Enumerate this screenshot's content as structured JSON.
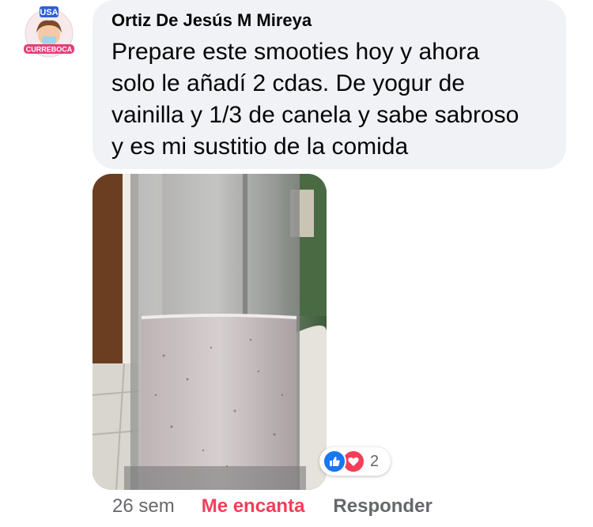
{
  "avatar": {
    "top_badge": "USA",
    "bottom_badge": "CURREBOCA",
    "badge_color": "#2f5fd6",
    "banner_color": "#e0407a"
  },
  "comment": {
    "author": "Ortiz De Jesús M Mireya",
    "text": "Prepare este smooties hoy y ahora\nsolo le añadí  2 cdas. De yogur de\nvainilla y 1/3 de canela y sabe sabroso\ny es mi sustitio de la comida",
    "bubble_color": "#f0f2f5"
  },
  "reactions": {
    "icons": [
      "like-icon",
      "love-icon"
    ],
    "count": "2",
    "like_color": "#1877f2",
    "love_color": "#f33e58"
  },
  "meta": {
    "time": "26 sem",
    "reaction_label": "Me encanta",
    "reply_label": "Responder"
  }
}
